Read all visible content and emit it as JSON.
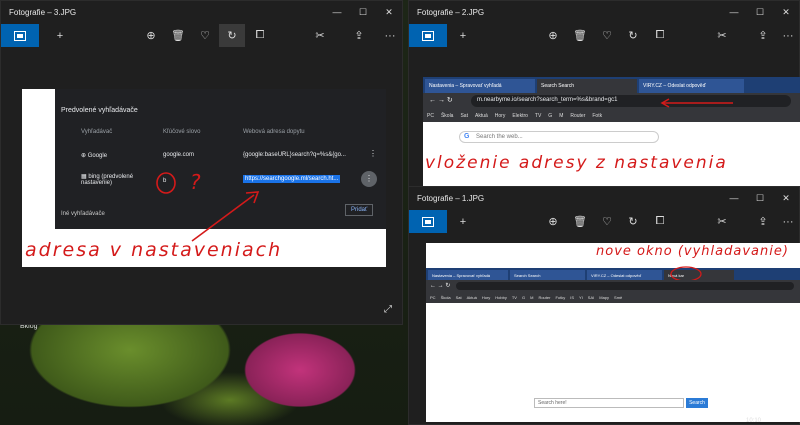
{
  "desktop": {
    "label": "Bklog"
  },
  "win1": {
    "title": "Fotografie – 3.JPG",
    "controls": [
      "—",
      "☐",
      "✕"
    ],
    "toolbar": {
      "add": "+",
      "zoom": "⊕",
      "delete": "🗑",
      "fav": "♡",
      "rotate": "↻",
      "crop": "⧠",
      "edit": "✂",
      "share": "⇪",
      "more": "···"
    },
    "photo": {
      "heading": "Predvolené vyhľadávače",
      "columns": [
        "Vyhľadávač",
        "Kľúčové slovo",
        "Webová adresa dopytu"
      ],
      "rows": [
        {
          "name": "Google",
          "keyword": "google.com",
          "url": "{google:baseURL}search?q=%s&{go..."
        },
        {
          "name": "bing (predvolené nastavenie)",
          "keyword": "b",
          "url": "https://searchgoogle.ml/search.ht..."
        }
      ],
      "other": "Iné vyhľadávače",
      "add_button": "Pridať",
      "annot_q": "?",
      "annot_text": "adresa v nastaveniach"
    }
  },
  "win2": {
    "title": "Fotografie – 2.JPG",
    "controls": [
      "—",
      "☐",
      "✕"
    ],
    "photo": {
      "tabs": [
        "Nastavenia – Spravovať vyhľadá",
        "Search Search",
        "VIRY.CZ – Odeslat odpověď"
      ],
      "address": "m.nearbyme.io/search?search_term=%s&brand=gc1",
      "bookmarks": [
        "PC",
        "Škola",
        "Sat",
        "Aktuá",
        "Hory",
        "Elektro",
        "TV",
        "G",
        "M",
        "Router",
        "Fotk"
      ],
      "google_placeholder": "Search the web...",
      "annot_text": "vloženie adresy z nastavenia"
    }
  },
  "win3": {
    "title": "Fotografie – 1.JPG",
    "photo": {
      "tabs": [
        "Nastavenia – Spravovať vyhľadá",
        "Search Search",
        "VIRY.CZ – Odeslat odpověď",
        "Nová kar"
      ],
      "bookmarks": [
        "PC",
        "Škola",
        "Sat",
        "Aktuá",
        "Hory",
        "Hobby",
        "TV",
        "G",
        "M",
        "Router",
        "Fotky",
        "IS",
        "YI",
        "SAI",
        "Mapy",
        "Smě"
      ],
      "search_placeholder": "Search here!",
      "search_button": "Search",
      "annot_text": "nove okno (vyhladavanie)"
    }
  },
  "clock": "10:10"
}
